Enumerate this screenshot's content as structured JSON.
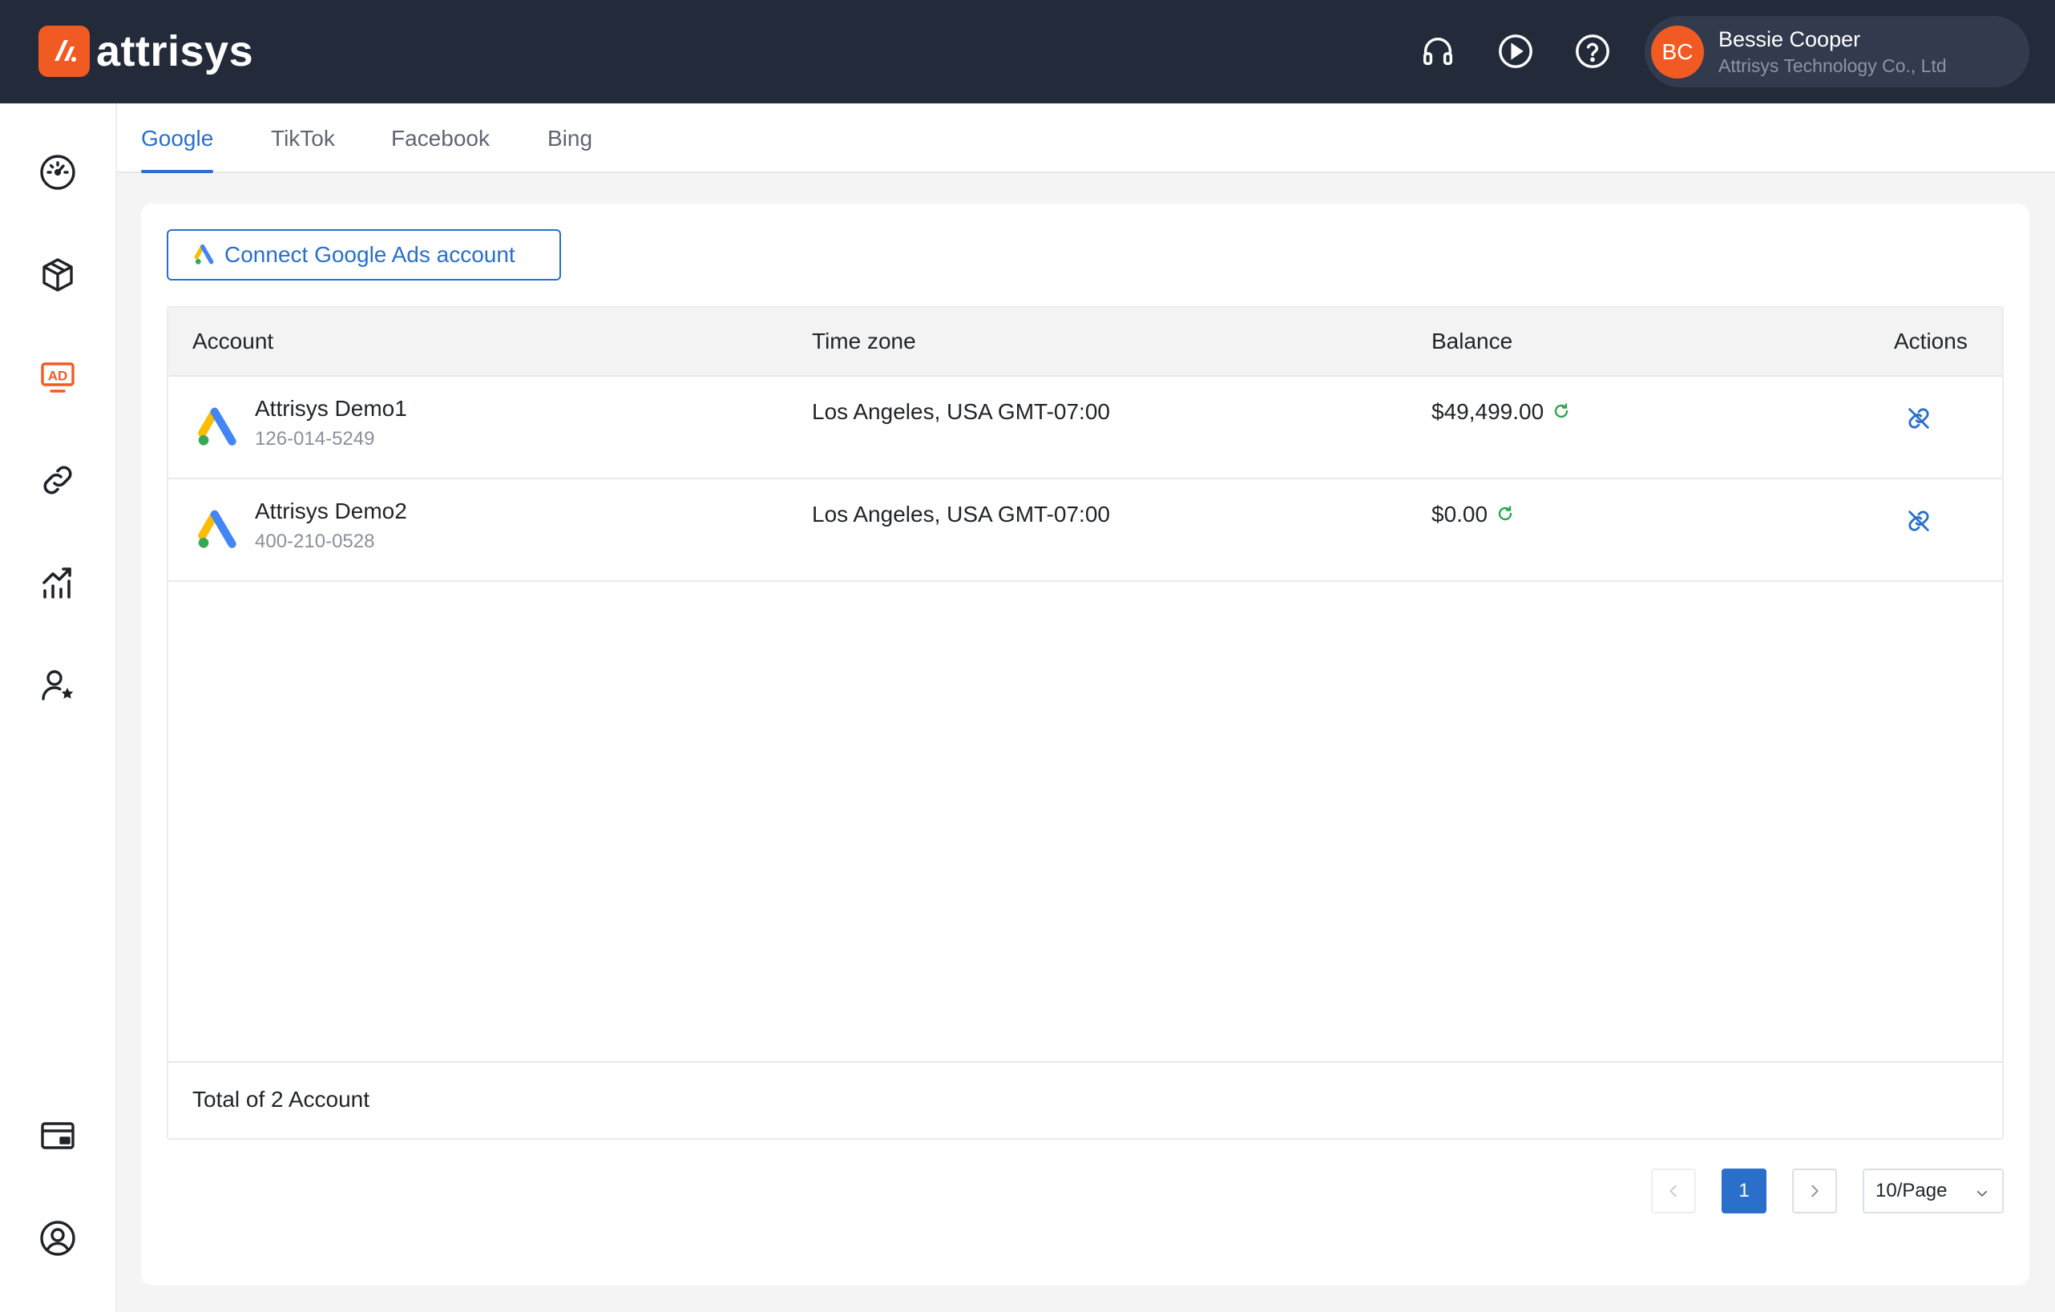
{
  "app": {
    "brand": "attrisys",
    "brand_color": "#f25a24",
    "accent_color": "#2a6fc9"
  },
  "header": {
    "icons": [
      "headset-icon",
      "play-circle-icon",
      "help-circle-icon"
    ],
    "user": {
      "initials": "BC",
      "name": "Bessie Cooper",
      "org": "Attrisys Technology Co., Ltd"
    }
  },
  "sidebar": {
    "items": [
      "dashboard-icon",
      "box-icon",
      "ad-icon",
      "link-icon",
      "analytics-icon",
      "user-star-icon",
      "wallet-icon",
      "account-circle-icon"
    ],
    "active": "ad-icon"
  },
  "tabs": [
    {
      "label": "Google",
      "active": true
    },
    {
      "label": "TikTok",
      "active": false
    },
    {
      "label": "Facebook",
      "active": false
    },
    {
      "label": "Bing",
      "active": false
    }
  ],
  "toolbar": {
    "connect_label": "Connect Google Ads account"
  },
  "table": {
    "columns": {
      "account": "Account",
      "timezone": "Time zone",
      "balance": "Balance",
      "actions": "Actions"
    },
    "rows": [
      {
        "name": "Attrisys Demo1",
        "id": "126-014-5249",
        "timezone": "Los Angeles, USA GMT-07:00",
        "balance": "$49,499.00"
      },
      {
        "name": "Attrisys Demo2",
        "id": "400-210-0528",
        "timezone": "Los Angeles, USA GMT-07:00",
        "balance": "$0.00"
      }
    ],
    "footer": "Total of 2 Account"
  },
  "pagination": {
    "current_page": "1",
    "page_size": "10/Page"
  }
}
